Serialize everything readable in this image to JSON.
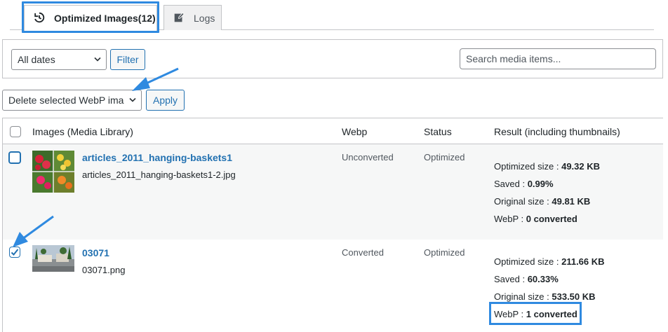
{
  "tabs": [
    {
      "label": "Optimized Images(12)",
      "icon": "history-icon",
      "active": true
    },
    {
      "label": "Logs",
      "icon": "edit-page-icon",
      "active": false
    }
  ],
  "filters": {
    "date_select": "All dates",
    "filter_button": "Filter",
    "search_placeholder": "Search media items..."
  },
  "bulk": {
    "action_select": "Delete selected WebP images",
    "apply_button": "Apply"
  },
  "table": {
    "headers": [
      "Images (Media Library)",
      "Webp",
      "Status",
      "Result (including thumbnails)"
    ],
    "rows": [
      {
        "checked": false,
        "title": "articles_2011_hanging-baskets1",
        "filename": "articles_2011_hanging-baskets1-2.jpg",
        "webp": "Unconverted",
        "status": "Optimized",
        "optimized_size": "49.32 KB",
        "saved": "0.99%",
        "original_size": "49.81 KB",
        "webp_count": "0 converted"
      },
      {
        "checked": true,
        "title": "03071",
        "filename": "03071.png",
        "webp": "Converted",
        "status": "Optimized",
        "optimized_size": "211.66 KB",
        "saved": "60.33%",
        "original_size": "533.50 KB",
        "webp_count": "1 converted"
      }
    ],
    "result_labels": {
      "optimized_size": "Optimized size : ",
      "saved": "Saved : ",
      "original_size": "Original size : ",
      "webp": "WebP : "
    }
  },
  "colors": {
    "accent": "#2271b1",
    "highlight": "#2f8ae0",
    "border": "#c3c4c7",
    "row_alt": "#f6f7f7"
  }
}
